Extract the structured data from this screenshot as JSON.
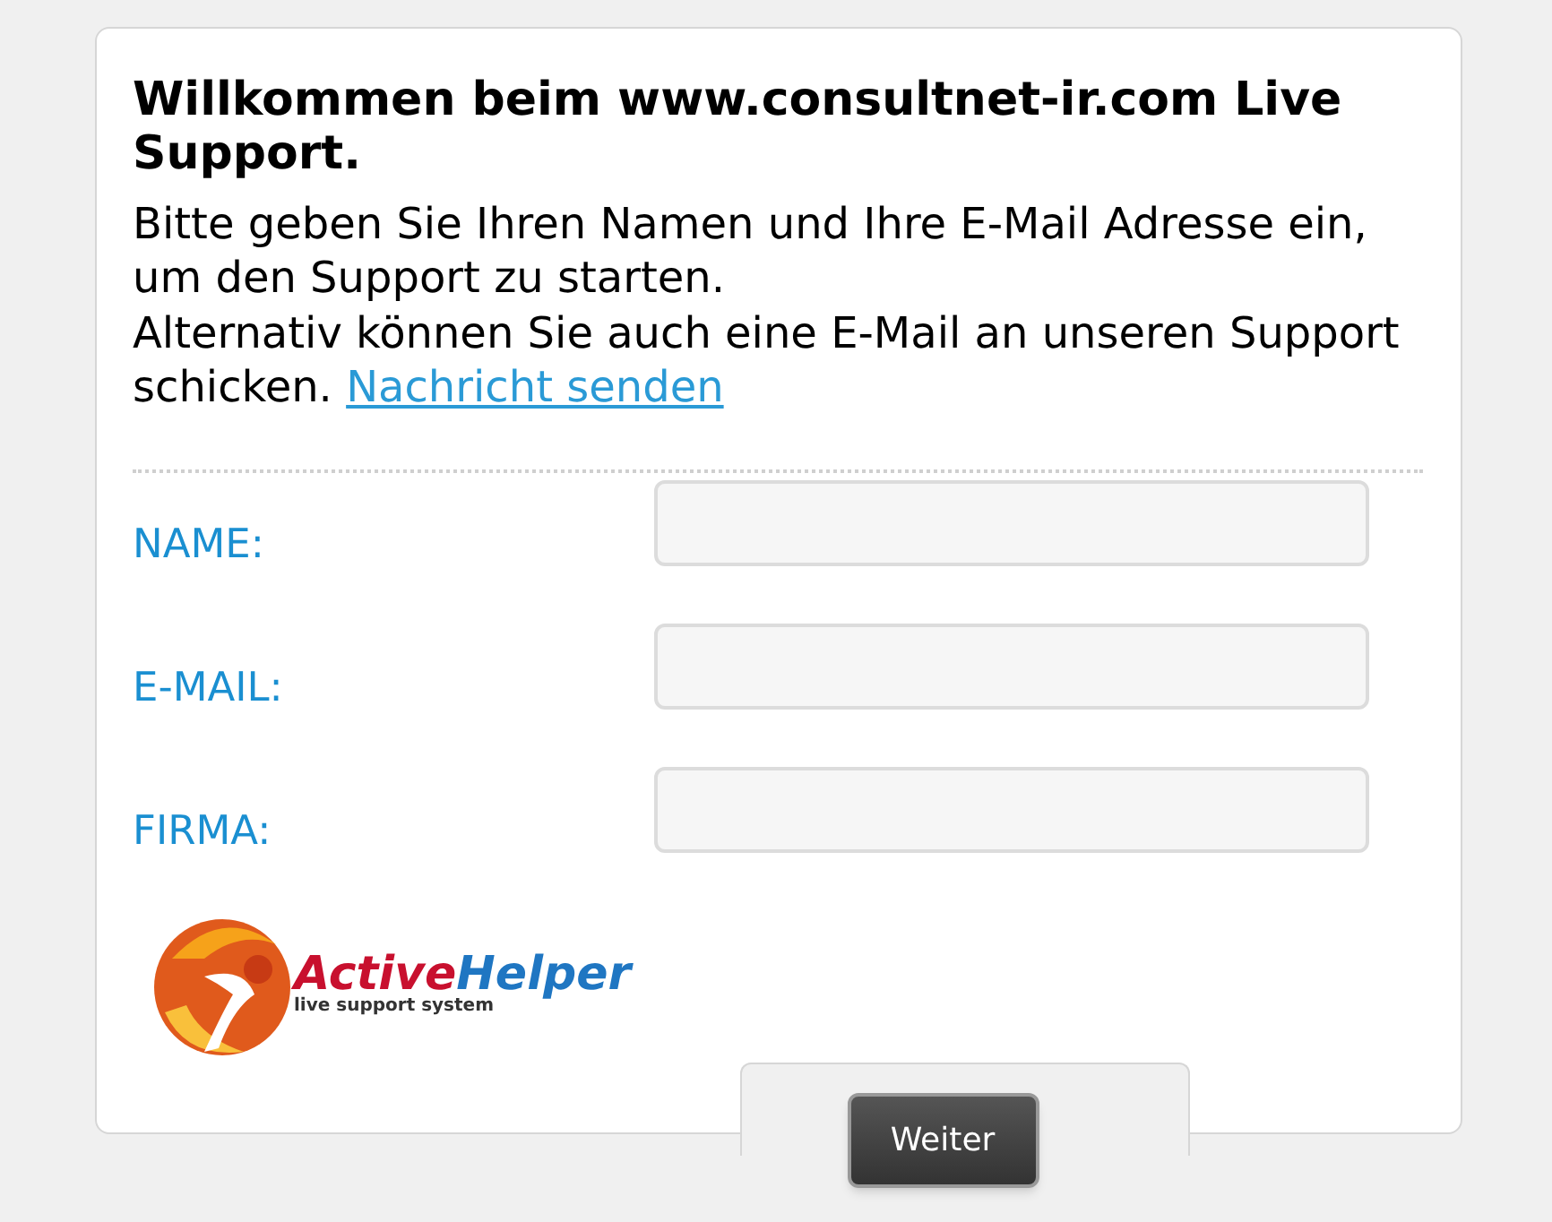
{
  "heading": "Willkommen beim www.consultnet-ir.com Live Support.",
  "intro": "Bitte geben Sie Ihren Namen und Ihre E-Mail Adresse ein, um den Support zu starten.",
  "alternative": {
    "text": "Alternativ können Sie auch eine E-Mail an unseren Support schicken.",
    "link": "Nachricht senden"
  },
  "fields": [
    {
      "label": "NAME:"
    },
    {
      "label": "E-MAIL:"
    },
    {
      "label": "FIRMA:"
    }
  ],
  "logo": {
    "name_first": "Active",
    "name_second": "Helper",
    "tagline": "live support system"
  },
  "submit_button": "Weiter"
}
